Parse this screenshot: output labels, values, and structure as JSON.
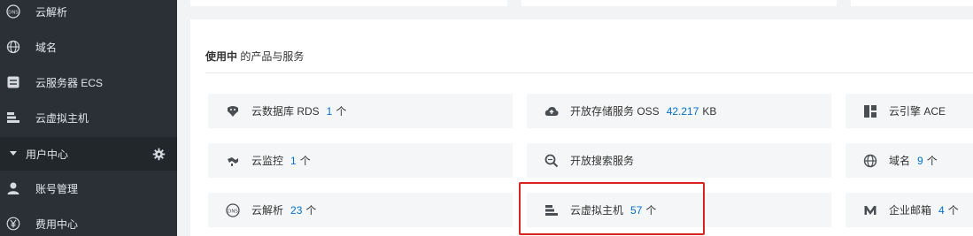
{
  "sidebar": {
    "items": [
      {
        "label": "云解析",
        "icon": "dns-icon"
      },
      {
        "label": "域名",
        "icon": "globe-icon"
      },
      {
        "label": "云服务器 ECS",
        "icon": "server-icon"
      },
      {
        "label": "云虚拟主机",
        "icon": "virtual-host-icon"
      }
    ],
    "section": {
      "label": "用户中心"
    },
    "sub_items": [
      {
        "label": "账号管理",
        "icon": "user-icon"
      },
      {
        "label": "费用中心",
        "icon": "yen-icon"
      }
    ]
  },
  "panel": {
    "title_bold": "使用中",
    "title_rest": " 的产品与服务"
  },
  "tiles": [
    {
      "name": "云数据库 RDS",
      "count": "1",
      "unit": "个",
      "icon": "database-icon"
    },
    {
      "name": "开放存储服务 OSS",
      "count": "42.217",
      "unit": "KB",
      "icon": "cloud-upload-icon"
    },
    {
      "name": "云引擎 ACE",
      "count": "",
      "unit": "",
      "icon": "grid-icon"
    },
    {
      "name": "云监控",
      "count": "1",
      "unit": "个",
      "icon": "monitor-icon"
    },
    {
      "name": "开放搜索服务",
      "count": "",
      "unit": "",
      "icon": "search-icon"
    },
    {
      "name": "域名",
      "count": "9",
      "unit": "个",
      "icon": "globe-icon"
    },
    {
      "name": "云解析",
      "count": "23",
      "unit": "个",
      "icon": "dns-icon"
    },
    {
      "name": "云虚拟主机",
      "count": "57",
      "unit": "个",
      "icon": "virtual-host-icon"
    },
    {
      "name": "企业邮箱",
      "count": "4",
      "unit": "个",
      "icon": "mail-icon"
    }
  ],
  "colors": {
    "sidebar_bg": "#2b3036",
    "section_bg": "#22272c",
    "accent_number": "#0070cc",
    "highlight": "#d9231f"
  }
}
